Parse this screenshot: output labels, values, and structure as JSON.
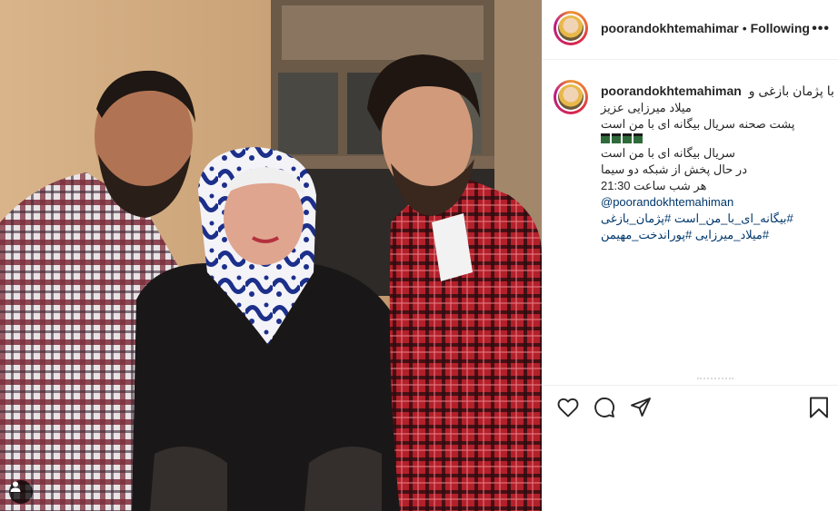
{
  "post": {
    "username": "poorandokhtemahimar",
    "separator": "•",
    "follow_status": "Following",
    "more_label": "•••"
  },
  "caption": {
    "username": "poorandokhtemahiman",
    "intro": "با پژمان بازغی و",
    "lines": [
      "میلاد میرزایی عزیز",
      "پشت صحنه سریال بیگانه ای با من است"
    ],
    "emoji": [
      "clapper-board-icon",
      "clapper-board-icon",
      "clapper-board-icon",
      "clapper-board-icon"
    ],
    "lines_after": [
      "سریال بیگانه ای با من است",
      "در حال پخش از شبکه دو سیما",
      "هر شب ساعت 21:30"
    ],
    "mention": "@poorandokhtemahiman",
    "hashtags_line1": "#بیگانه_ای_با_من_است #پژمان_بازغی",
    "hashtags_line2": "#میلاد_میرزایی #پوراندخت_مهیمن"
  },
  "actions": {
    "icons": [
      "heart-icon",
      "comment-icon",
      "share-icon",
      "bookmark-icon"
    ]
  },
  "photo": {
    "tag_icon": "user-tag-icon"
  },
  "colors": {
    "link": "#00376b",
    "text": "#262626",
    "divider": "#efefef"
  }
}
